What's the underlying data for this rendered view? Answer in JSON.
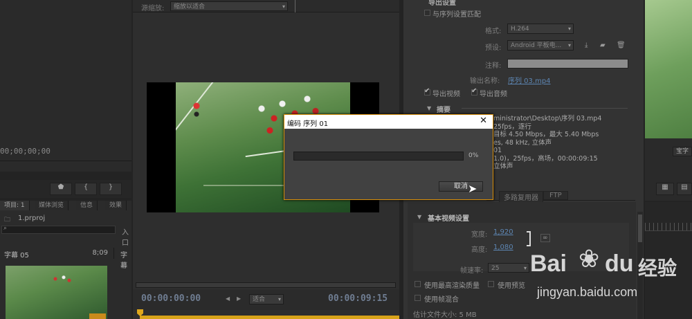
{
  "left_top": {
    "timecode": "00;00;00;00"
  },
  "project": {
    "tabs": [
      "项目: 1",
      "媒体浏览",
      "信息",
      "效果"
    ],
    "file": "1.prproj",
    "input_hint": "入口",
    "clip_name": "字幕 05",
    "clip_duration": "8;09",
    "clip_name2": "字幕"
  },
  "program": {
    "scale_label": "源缩放:",
    "scale_value": "缩放以适合",
    "timecode_left": "00:00:00:00",
    "fit_value": "适合",
    "timecode_right": "00:00:09:15"
  },
  "export": {
    "section_title": "导出设置",
    "match_sequence": "与序列设置匹配",
    "format_label": "格式:",
    "format_value": "H.264",
    "preset_label": "预设:",
    "preset_value": "Android 平板电...",
    "comment_label": "注释:",
    "output_label": "输出名称:",
    "output_value": "序列 03.mp4",
    "export_video": "导出视频",
    "export_audio": "导出音频",
    "summary_title": "摘要",
    "summary_lines": [
      "ministrator\\Desktop\\序列 03.mp4",
      "25fps，逐行",
      "目标 4.50 Mbps，最大 5.40 Mbps",
      "es, 48 kHz, 立体声",
      "01",
      "1.0)，25fps，高场，00:00:09:15",
      "立体声"
    ],
    "tabs": [
      "多路复用器",
      "FTP"
    ],
    "basic_video_title": "基本视频设置",
    "width_label": "宽度:",
    "width_value": "1,920",
    "height_label": "高度:",
    "height_value": "1,080",
    "fps_label": "帧速率:",
    "fps_value": "25",
    "max_quality": "使用最高渲染质量",
    "use_preview": "使用预览",
    "use_blend": "使用帧混合",
    "est_size": "估计文件大小: 5 MB"
  },
  "dialog": {
    "title": "编码 序列 01",
    "progress": 0,
    "progress_label": "0%",
    "cancel": "取消"
  },
  "right": {
    "button_label": "宝字"
  },
  "watermark": {
    "brand": "Bai",
    "brand2": "du",
    "suffix": "经验",
    "url": "jingyan.baidu.com"
  }
}
